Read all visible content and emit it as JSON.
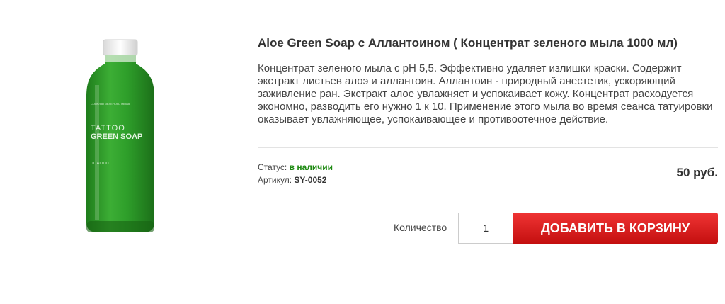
{
  "product": {
    "image": {
      "icon": "green-soap-bottle",
      "label_line1": "TATTOO",
      "label_line2": "GREEN SOAP",
      "brand": "ULTATTOO",
      "liquid_color": "#2e9e2a"
    },
    "title": "Aloe Green Soap с Аллантоином ( Концентрат зеленого мыла 1000 мл)",
    "description": "Концентрат зеленого мыла с pH 5,5. Эффективно удаляет излишки краски. Содержит экстракт листьев алоэ и аллантоин. Аллантоин - природный анестетик, ускоряющий заживление ран. Экстракт алое увлажняет и успокаивает кожу. Концентрат расходуется экономно, разводить его нужно 1 к 10. Применение этого мыла во время сеанса татуировки оказывает увлажняющее, успокаивающее и противоотечное действие.",
    "status_label": "Статус:",
    "status_value": "в наличии",
    "sku_label": "Артикул:",
    "sku_value": "SY-0052",
    "price": "50 руб."
  },
  "cart": {
    "quantity_label": "Количество",
    "quantity_value": "1",
    "add_button_label": "ДОБАВИТЬ В КОРЗИНУ"
  },
  "colors": {
    "status_green": "#1e8a12",
    "button_red": "#d91f1f"
  }
}
